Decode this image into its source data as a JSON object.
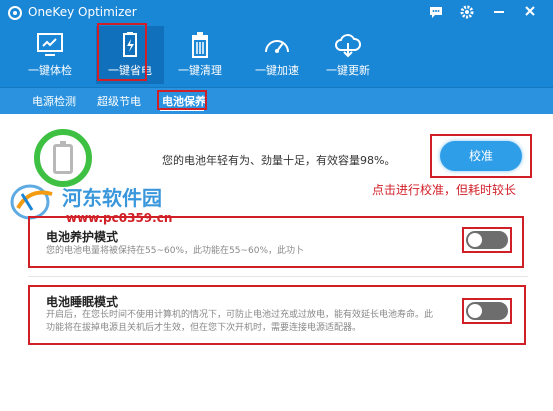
{
  "window": {
    "title": "OneKey Optimizer"
  },
  "toolbar": {
    "items": [
      {
        "label": "一键体检",
        "icon": "monitor-icon"
      },
      {
        "label": "一键省电",
        "icon": "battery-charging-icon"
      },
      {
        "label": "一键清理",
        "icon": "trash-icon"
      },
      {
        "label": "一键加速",
        "icon": "speedometer-icon"
      },
      {
        "label": "一键更新",
        "icon": "cloud-download-icon"
      }
    ],
    "active_index": 1
  },
  "subtabs": {
    "items": [
      "电源检测",
      "超级节电",
      "电池保养"
    ],
    "active": "电池保养"
  },
  "battery": {
    "status_text": "您的电池年轻有为、劲量十足，有效容量98%。",
    "calibrate_button": "校准",
    "annotation": "点击进行校准，但耗时较长"
  },
  "watermark": {
    "text": "河东软件园",
    "url": "www.pc0359.cn"
  },
  "modes": [
    {
      "title": "电池养护模式",
      "desc": "您的电池电量将被保持在55~60%，此功能在55~60%，此功卜",
      "enabled": false
    },
    {
      "title": "电池睡眠模式",
      "desc_line1": "开启后，在您长时间不使用计算机的情况下，可防止电池过充或过放电，能有效延长电池寿命。此",
      "desc_line2": "功能将在拔掉电源且关机后才生效，但在您下次开机时，需要连接电源适配器。",
      "enabled": false
    }
  ],
  "colors": {
    "brand_blue": "#1a86d6",
    "highlight_red": "#d11f27",
    "battery_green": "#3ec142"
  }
}
